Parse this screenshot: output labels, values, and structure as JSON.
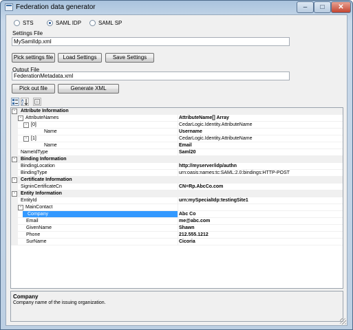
{
  "window": {
    "title": "Federation data generator"
  },
  "mode": {
    "options": [
      "STS",
      "SAML IDP",
      "SAML SP"
    ],
    "selected": "SAML IDP"
  },
  "settings": {
    "label": "Settings File",
    "value": "MySamlIdp.xml",
    "buttons": {
      "pick": "Pick settings file",
      "load": "Load Settings",
      "save": "Save Settings"
    }
  },
  "output": {
    "label": "Output File",
    "value": "FederationMetadata.xml",
    "buttons": {
      "pick": "Pick out file",
      "generate": "Generate XML"
    }
  },
  "grid": {
    "rows": [
      {
        "kind": "category",
        "name": "Attribute Information",
        "expander": "-"
      },
      {
        "kind": "prop",
        "indent": 1,
        "name": "AttributeNames",
        "value": "AttributeName[] Array",
        "bold": true,
        "expander": "-"
      },
      {
        "kind": "prop",
        "indent": 2,
        "name": "[0]",
        "value": "CedarLogic.Identity.AttributeName",
        "bold": false,
        "expander": "-"
      },
      {
        "kind": "prop",
        "indent": 3,
        "name": "Name",
        "value": "Username",
        "bold": true
      },
      {
        "kind": "prop",
        "indent": 2,
        "name": "[1]",
        "value": "CedarLogic.Identity.AttributeName",
        "bold": false,
        "expander": "-"
      },
      {
        "kind": "prop",
        "indent": 3,
        "name": "Name",
        "value": "Email",
        "bold": true
      },
      {
        "kind": "prop",
        "indent": 1,
        "name": "NameIdType",
        "value": "Saml20",
        "bold": true
      },
      {
        "kind": "category",
        "name": "Binding Information",
        "expander": "-"
      },
      {
        "kind": "prop",
        "indent": 1,
        "name": "BindingLocation",
        "value": "http://myserver/idp/authn",
        "bold": true
      },
      {
        "kind": "prop",
        "indent": 1,
        "name": "BindingType",
        "value": "urn:oasis:names:tc:SAML:2.0:bindings:HTTP-POST",
        "bold": false
      },
      {
        "kind": "category",
        "name": "Certificate Information",
        "expander": "-"
      },
      {
        "kind": "prop",
        "indent": 1,
        "name": "SigninCertificateCn",
        "value": "CN=Rp.AbcCo.com",
        "bold": true
      },
      {
        "kind": "category",
        "name": "Entity Information",
        "expander": "-"
      },
      {
        "kind": "prop",
        "indent": 1,
        "name": "EntityId",
        "value": "urn:mySpecialIdp:testingSite1",
        "bold": true
      },
      {
        "kind": "prop",
        "indent": 1,
        "name": "MainContact",
        "value": "",
        "bold": false,
        "expander": "-"
      },
      {
        "kind": "prop",
        "indent": 2,
        "name": "Company",
        "value": "Abc Co",
        "bold": true,
        "selected": true
      },
      {
        "kind": "prop",
        "indent": 2,
        "name": "Email",
        "value": "me@abc.com",
        "bold": true
      },
      {
        "kind": "prop",
        "indent": 2,
        "name": "GivenName",
        "value": "Shawn",
        "bold": true
      },
      {
        "kind": "prop",
        "indent": 2,
        "name": "Phone",
        "value": "212.555.1212",
        "bold": true
      },
      {
        "kind": "prop",
        "indent": 2,
        "name": "SurName",
        "value": "Cicoria",
        "bold": true
      }
    ]
  },
  "description": {
    "title": "Company",
    "text": "Company name of the issuing organization."
  },
  "icons": {
    "categorized": "categorized-icon",
    "alphabetical": "sort-az-icon",
    "pages": "property-pages-icon"
  },
  "colors": {
    "selection": "#3399ff",
    "category_bg": "#f0f0f0"
  }
}
